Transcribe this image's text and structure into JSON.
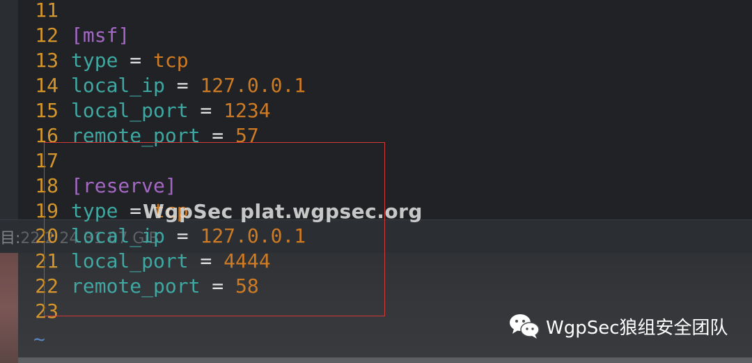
{
  "editor": {
    "lines": [
      {
        "num": "11",
        "parts": []
      },
      {
        "num": "12",
        "parts": [
          {
            "cls": "section",
            "text": "[msf]"
          }
        ]
      },
      {
        "num": "13",
        "parts": [
          {
            "cls": "key",
            "text": "type"
          },
          {
            "cls": "op",
            "text": " = "
          },
          {
            "cls": "val-str",
            "text": "tcp"
          }
        ]
      },
      {
        "num": "14",
        "parts": [
          {
            "cls": "key",
            "text": "local_ip"
          },
          {
            "cls": "op",
            "text": " = "
          },
          {
            "cls": "val-num",
            "text": "127.0.0.1"
          }
        ]
      },
      {
        "num": "15",
        "parts": [
          {
            "cls": "key",
            "text": "local_port"
          },
          {
            "cls": "op",
            "text": " = "
          },
          {
            "cls": "val-num",
            "text": "1234"
          }
        ]
      },
      {
        "num": "16",
        "parts": [
          {
            "cls": "key",
            "text": "remote_port"
          },
          {
            "cls": "op",
            "text": " = "
          },
          {
            "cls": "val-num",
            "text": "57"
          }
        ]
      },
      {
        "num": "17",
        "parts": []
      },
      {
        "num": "18",
        "parts": [
          {
            "cls": "section",
            "text": "[reserve]"
          }
        ]
      },
      {
        "num": "19",
        "parts": [
          {
            "cls": "key",
            "text": "type"
          },
          {
            "cls": "op",
            "text": " = "
          },
          {
            "cls": "val-str",
            "text": "tcp"
          }
        ]
      },
      {
        "num": "20",
        "parts": [
          {
            "cls": "key",
            "text": "local_ip"
          },
          {
            "cls": "op",
            "text": " = "
          },
          {
            "cls": "val-num",
            "text": "127.0.0.1"
          }
        ]
      },
      {
        "num": "21",
        "parts": [
          {
            "cls": "key",
            "text": "local_port"
          },
          {
            "cls": "op",
            "text": " = "
          },
          {
            "cls": "val-num",
            "text": "4444"
          }
        ]
      },
      {
        "num": "22",
        "parts": [
          {
            "cls": "key",
            "text": "remote_port"
          },
          {
            "cls": "op",
            "text": " = "
          },
          {
            "cls": "val-num",
            "text": "58"
          }
        ]
      },
      {
        "num": "23",
        "parts": []
      }
    ],
    "empty_line_marker": "~"
  },
  "terminal_status": {
    "prefix": "目:",
    "text": "22.2        24        31         07 GiB"
  },
  "watermark": "WgpSec plat.wgpsec.org",
  "brand": {
    "icon": "wechat-icon",
    "text": "WgpSec狼组安全团队"
  },
  "colors": {
    "line_number": "#d4962c",
    "section": "#a468c4",
    "key": "#3fa8a2",
    "value": "#cf7b24",
    "highlight_box": "#d23a3a",
    "tilde": "#5a86c4"
  }
}
